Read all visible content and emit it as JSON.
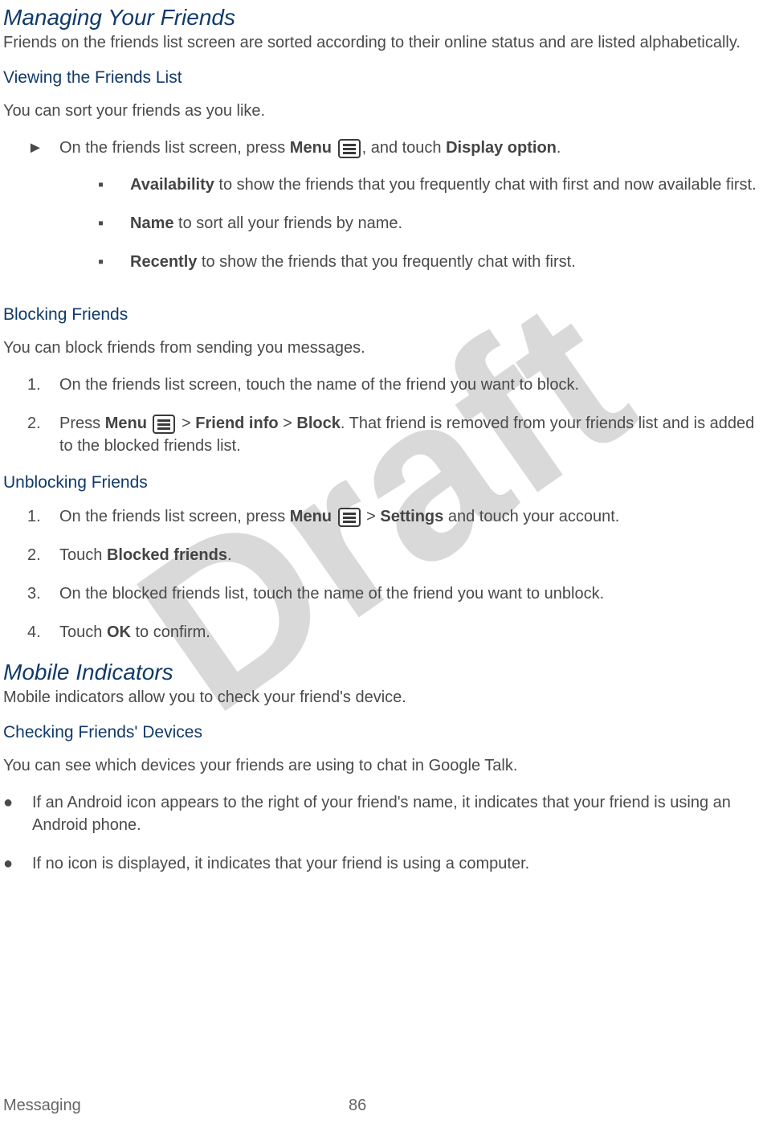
{
  "watermark": "Draft",
  "sections": {
    "s1": {
      "title": "Managing Your Friends",
      "intro": "Friends on the friends list screen are sorted according to their online status and are listed alphabetically."
    },
    "s1a": {
      "title": "Viewing the Friends List",
      "intro": "You can sort your friends as you like.",
      "step_marker": "►",
      "step_pre": "On the friends list screen, press ",
      "step_bold1": "Menu",
      "step_mid": ", and touch ",
      "step_bold2": "Display option",
      "step_post": ".",
      "opt_marker": "▪",
      "opts": {
        "a_b": "Availability",
        "a_t": " to show the friends that you frequently chat with first and now available first.",
        "b_b": "Name",
        "b_t": " to sort all your friends by name.",
        "c_b": "Recently",
        "c_t": " to show the friends that you frequently chat with first."
      }
    },
    "s1b": {
      "title": "Blocking Friends",
      "intro": "You can block friends from sending you messages.",
      "n1": "1.",
      "t1": "On the friends list screen, touch the name of the friend you want to block.",
      "n2": "2.",
      "t2_pre": "Press ",
      "t2_b1": "Menu",
      "t2_mid1": "  > ",
      "t2_b2": "Friend info",
      "t2_mid2": " > ",
      "t2_b3": "Block",
      "t2_post": ". That friend is removed from your friends list and is added to the blocked friends list."
    },
    "s1c": {
      "title": "Unblocking Friends",
      "n1": "1.",
      "t1_pre": "On the friends list screen, press ",
      "t1_b1": "Menu",
      "t1_mid": "  > ",
      "t1_b2": "Settings",
      "t1_post": " and touch your account.",
      "n2": "2.",
      "t2_pre": "Touch ",
      "t2_b": "Blocked friends",
      "t2_post": ".",
      "n3": "3.",
      "t3": "On the blocked friends list, touch the name of the friend you want to unblock.",
      "n4": "4.",
      "t4_pre": "Touch ",
      "t4_b": "OK",
      "t4_post": " to confirm."
    },
    "s2": {
      "title": "Mobile Indicators",
      "intro": "Mobile indicators allow you to check your friend's device."
    },
    "s2a": {
      "title": "Checking Friends' Devices",
      "intro": "You can see which devices your friends are using to chat in Google Talk.",
      "bm": "●",
      "b1": "If an Android icon appears to the right of your friend's name, it indicates that your friend is using an Android phone.",
      "b2": "If no icon is displayed, it indicates that your friend is using a computer."
    }
  },
  "footer": {
    "title": "Messaging",
    "page": "86"
  }
}
